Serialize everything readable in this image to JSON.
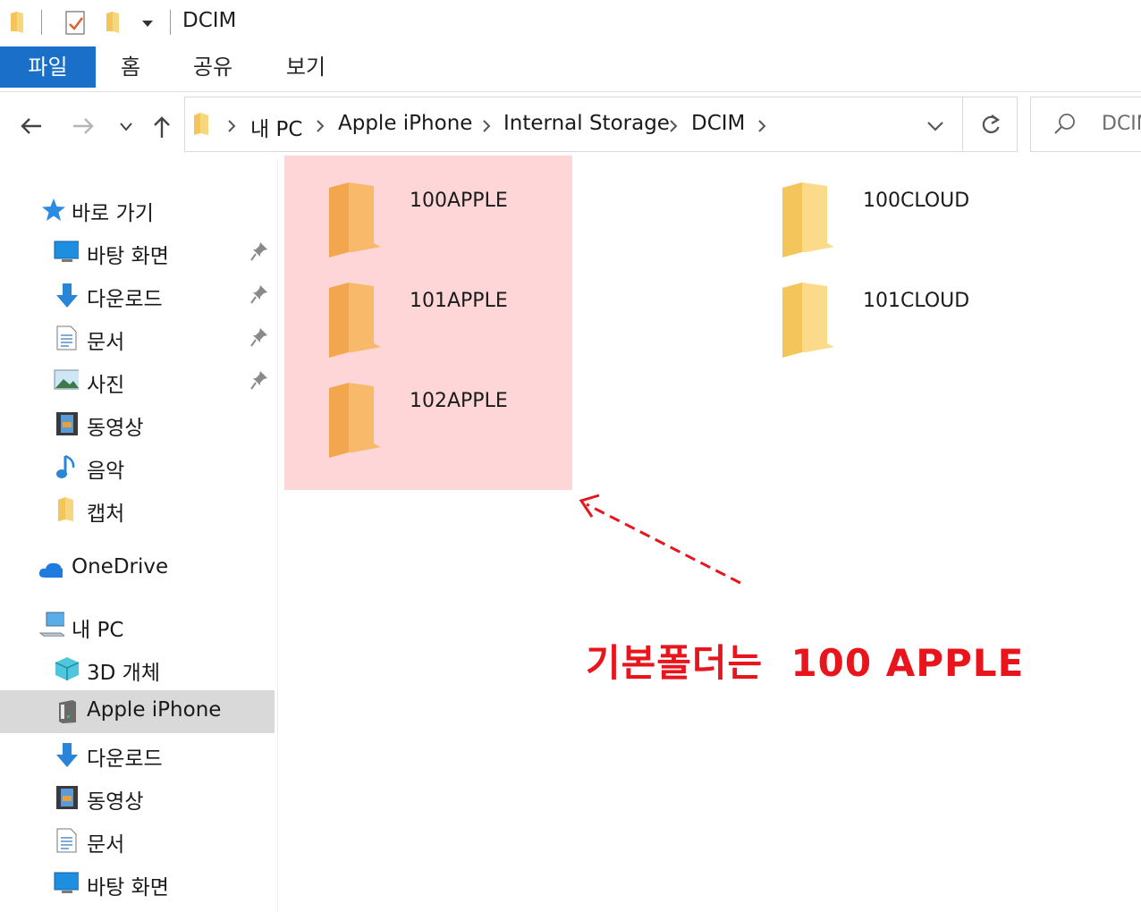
{
  "window": {
    "title": "DCIM"
  },
  "ribbon": {
    "tabs": [
      "파일",
      "홈",
      "공유",
      "보기"
    ]
  },
  "address": {
    "crumbs": [
      "내 PC",
      "Apple iPhone",
      "Internal Storage",
      "DCIM"
    ],
    "search_placeholder": "DCIM"
  },
  "sidebar": {
    "quick_access": {
      "label": "바로 가기",
      "items": [
        {
          "label": "바탕 화면",
          "icon": "desktop-icon",
          "pinned": true
        },
        {
          "label": "다운로드",
          "icon": "download-icon",
          "pinned": true
        },
        {
          "label": "문서",
          "icon": "document-icon",
          "pinned": true
        },
        {
          "label": "사진",
          "icon": "picture-icon",
          "pinned": true
        },
        {
          "label": "동영상",
          "icon": "video-icon",
          "pinned": false
        },
        {
          "label": "음악",
          "icon": "music-icon",
          "pinned": false
        },
        {
          "label": "캡처",
          "icon": "folder-icon",
          "pinned": false
        }
      ]
    },
    "onedrive": {
      "label": "OneDrive"
    },
    "this_pc": {
      "label": "내 PC",
      "items": [
        {
          "label": "3D 개체",
          "icon": "3d-objects-icon"
        },
        {
          "label": "Apple iPhone",
          "icon": "phone-device-icon",
          "selected": true
        },
        {
          "label": "다운로드",
          "icon": "download-icon"
        },
        {
          "label": "동영상",
          "icon": "video-icon"
        },
        {
          "label": "문서",
          "icon": "document-icon"
        },
        {
          "label": "바탕 화면",
          "icon": "desktop-icon"
        }
      ]
    }
  },
  "folders": [
    {
      "name": "100APPLE",
      "highlighted": true
    },
    {
      "name": "100CLOUD",
      "highlighted": false
    },
    {
      "name": "101APPLE",
      "highlighted": true
    },
    {
      "name": "101CLOUD",
      "highlighted": false
    },
    {
      "name": "102APPLE",
      "highlighted": true
    }
  ],
  "annotation": {
    "text": "기본폴더는  100 APPLE",
    "color": "#e8161c"
  },
  "colors": {
    "file_tab": "#1a70c8",
    "highlight": "#ffd6d8",
    "selected_row": "#d9d9d9"
  }
}
